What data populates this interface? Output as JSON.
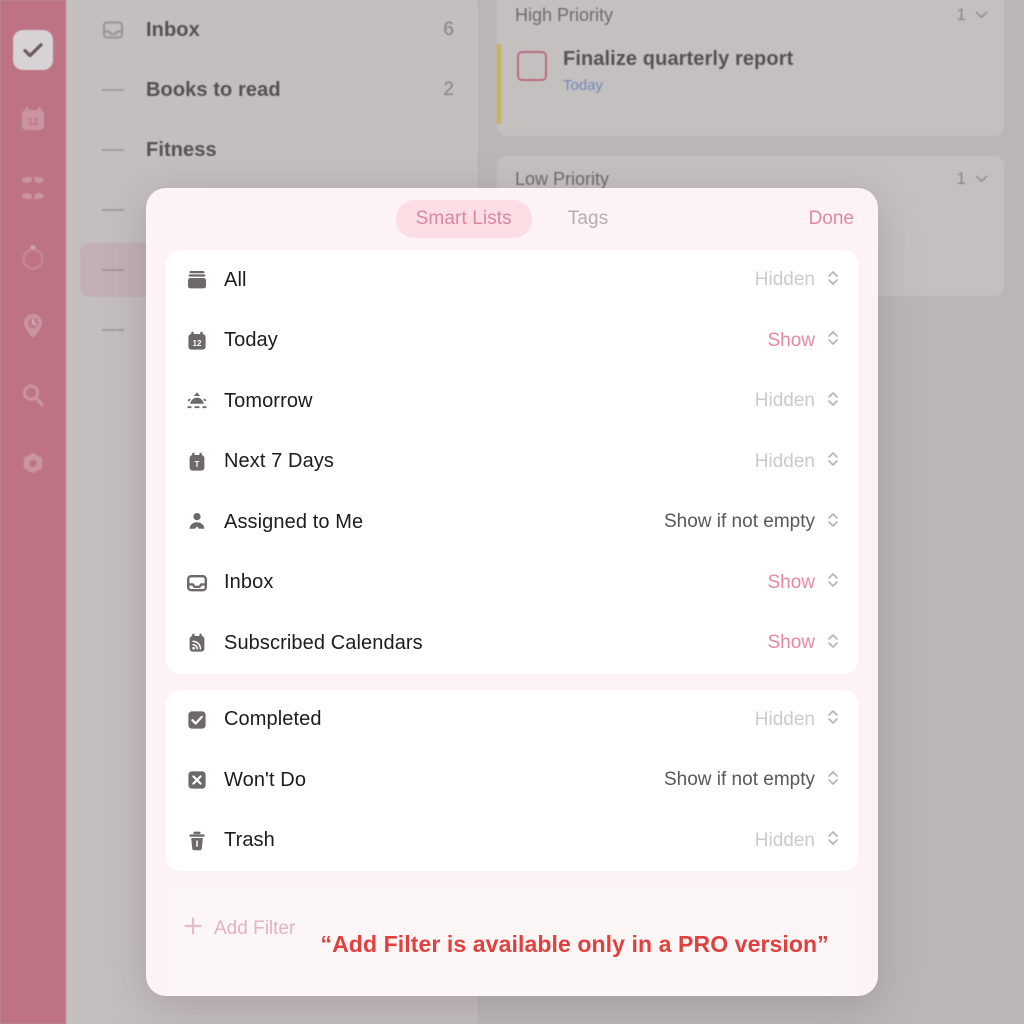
{
  "rail": {
    "items": [
      {
        "name": "tasks",
        "icon": "checkmark-icon",
        "active": true
      },
      {
        "name": "calendar",
        "icon": "calendar-12-icon",
        "active": false
      },
      {
        "name": "matrix",
        "icon": "grid-four-icon",
        "active": false
      },
      {
        "name": "pomodoro",
        "icon": "timer-icon",
        "active": false
      },
      {
        "name": "habit",
        "icon": "clock-pin-icon",
        "active": false
      },
      {
        "name": "search",
        "icon": "search-icon",
        "active": false
      },
      {
        "name": "settings",
        "icon": "hexagon-settings-icon",
        "active": false
      }
    ]
  },
  "list_panel": {
    "rows": [
      {
        "label": "Inbox",
        "count": "6",
        "icon": "inbox-icon",
        "selected": false
      },
      {
        "label": "Books to read",
        "count": "2",
        "icon": "hamburger-icon",
        "selected": false
      },
      {
        "label": "Fitness",
        "count": "",
        "icon": "hamburger-icon",
        "selected": false
      },
      {
        "label": "",
        "count": "",
        "icon": "hamburger-icon",
        "selected": false
      },
      {
        "label": "",
        "count": "",
        "icon": "hamburger-icon",
        "selected": true
      },
      {
        "label": "",
        "count": "",
        "icon": "hamburger-icon",
        "selected": false
      }
    ]
  },
  "detail_panel": {
    "sections": [
      {
        "title": "High Priority",
        "count": "1",
        "task": {
          "title": "Finalize quarterly report",
          "due": "Today"
        }
      },
      {
        "title": "Low Priority",
        "count": "1",
        "task": null
      }
    ]
  },
  "modal": {
    "tabs": [
      {
        "label": "Smart Lists",
        "active": true
      },
      {
        "label": "Tags",
        "active": false
      }
    ],
    "done_label": "Done",
    "groups": [
      {
        "rows": [
          {
            "label": "All",
            "icon": "archive-box-icon",
            "value": "Hidden",
            "state": "hidden"
          },
          {
            "label": "Today",
            "icon": "calendar-12-icon",
            "value": "Show",
            "state": "show"
          },
          {
            "label": "Tomorrow",
            "icon": "sunrise-icon",
            "value": "Hidden",
            "state": "hidden"
          },
          {
            "label": "Next 7 Days",
            "icon": "calendar-t-icon",
            "value": "Hidden",
            "state": "hidden"
          },
          {
            "label": "Assigned to Me",
            "icon": "person-icon",
            "value": "Show if not empty",
            "state": "cond"
          },
          {
            "label": "Inbox",
            "icon": "inbox-icon",
            "value": "Show",
            "state": "show"
          },
          {
            "label": "Subscribed Calendars",
            "icon": "rss-calendar-icon",
            "value": "Show",
            "state": "show"
          }
        ]
      },
      {
        "rows": [
          {
            "label": "Completed",
            "icon": "checkbox-checked-icon",
            "value": "Hidden",
            "state": "hidden"
          },
          {
            "label": "Won't Do",
            "icon": "x-square-icon",
            "value": "Show if not empty",
            "state": "cond"
          },
          {
            "label": "Trash",
            "icon": "trash-icon",
            "value": "Hidden",
            "state": "hidden"
          }
        ]
      }
    ],
    "add_filter_label": "Add Filter",
    "promo_text": "“Add Filter is available only in a PRO version”"
  },
  "colors": {
    "rail": "#c9546f",
    "accent_pink": "#e8889f",
    "promo_red": "#e0413f",
    "priority_yellow": "#d8bb33",
    "due_blue": "#4d77c4"
  }
}
